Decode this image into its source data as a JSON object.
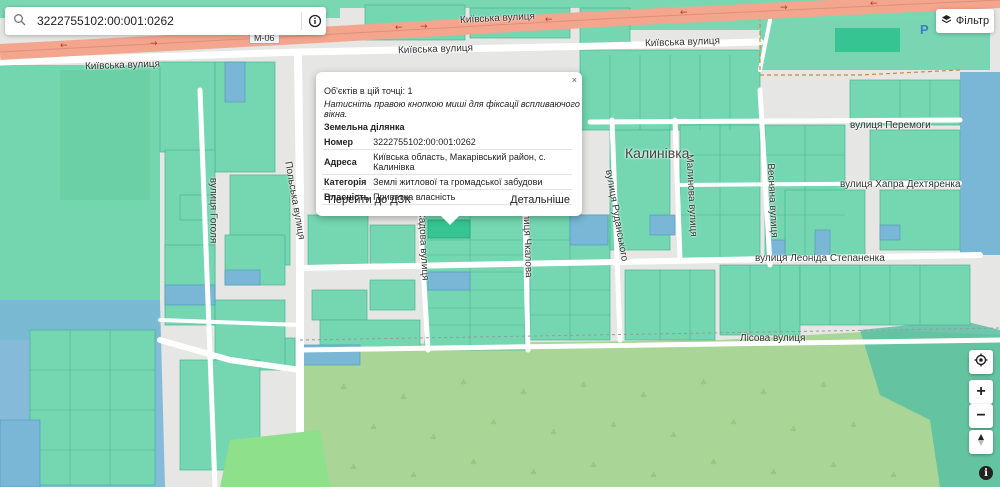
{
  "search": {
    "value": "3222755102:00:001:0262"
  },
  "filter_label": "Фільтр",
  "map": {
    "route_shield": "М-06",
    "village": "Калинівка",
    "parking_marker": "P",
    "streets": {
      "kyivska_1": "Київська вулиця",
      "kyivska_2": "Київська вулиця",
      "kyivska_3": "Київська вулиця",
      "kyivska_4": "Київська вулиця",
      "gogolya": "вулиця Гоголя",
      "polska": "Польська вулиця",
      "sadova": "Садова вулиця",
      "chkalova": "вулиця Чкалова",
      "rudanskoho": "вулиця Руданського",
      "malinova": "Малинова вулиця",
      "vesnyana": "Весняна вулиця",
      "peremohy": "вулиця Перемоги",
      "dekhtiarenka": "вулиця Хапра Дехтяренка",
      "stepanenka": "вулиця Леоніда Степаненка",
      "lisova": "Лісова вулиця"
    }
  },
  "popup": {
    "close": "×",
    "count": "Об'єктів в цій точці: 1",
    "hint": "Натисніть правою кнопкою миші для фіксації вспливаючого вікна.",
    "section_title": "Земельна ділянка",
    "rows": [
      {
        "key": "Номер",
        "value": "3222755102:00:001:0262"
      },
      {
        "key": "Адреса",
        "value": "Київська область, Макарівський район, с. Калинівка"
      },
      {
        "key": "Категорія",
        "value": "Землі житлової та громадської забудови"
      },
      {
        "key": "Власність",
        "value": "Приватна власність"
      }
    ],
    "btn_dzk": "Перейти до ДЗК",
    "btn_details": "Детальніше"
  },
  "controls": {
    "zoom_in": "+",
    "zoom_out": "−",
    "info": "i"
  },
  "colors": {
    "parcel": "#6fd7b0",
    "parcel_blue": "#7ab6d6",
    "forest": "#a7d293",
    "highway": "#f4a58e",
    "road": "#ffffff",
    "selected": "#35c492"
  }
}
